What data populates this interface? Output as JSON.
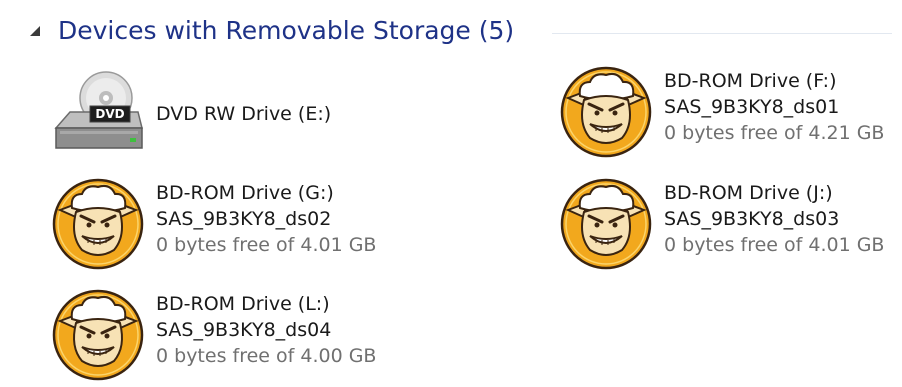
{
  "group": {
    "title": "Devices with Removable Storage (5)"
  },
  "devices": [
    {
      "name": "DVD RW Drive (E:)",
      "icon": "dvd-drive-icon",
      "badge": "DVD"
    },
    {
      "name": "BD-ROM Drive (F:)",
      "label": "SAS_9B3KY8_ds01",
      "space": "0 bytes free of 4.21 GB",
      "icon": "sheep-mascot-icon"
    },
    {
      "name": "BD-ROM Drive (G:)",
      "label": "SAS_9B3KY8_ds02",
      "space": "0 bytes free of 4.01 GB",
      "icon": "sheep-mascot-icon"
    },
    {
      "name": "BD-ROM Drive (J:)",
      "label": "SAS_9B3KY8_ds03",
      "space": "0 bytes free of 4.01 GB",
      "icon": "sheep-mascot-icon"
    },
    {
      "name": "BD-ROM Drive (L:)",
      "label": "SAS_9B3KY8_ds04",
      "space": "0 bytes free of 4.00 GB",
      "icon": "sheep-mascot-icon"
    }
  ],
  "colors": {
    "header_text": "#1e3287",
    "mascot_orange": "#f2a81d",
    "mascot_outline": "#3a2410",
    "secondary_text": "#707070"
  }
}
